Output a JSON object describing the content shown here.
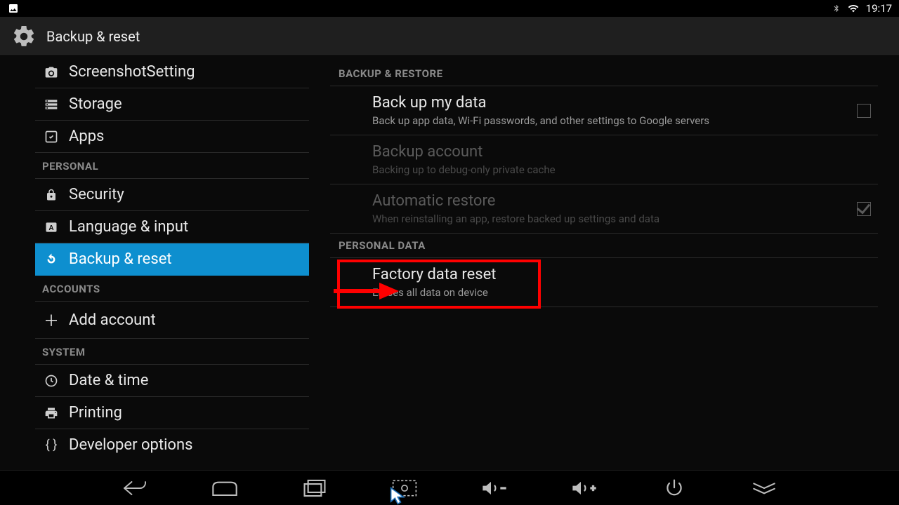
{
  "statusbar": {
    "time": "19:17"
  },
  "appbar": {
    "title": "Backup & reset"
  },
  "sidebar": {
    "items": [
      {
        "type": "item",
        "icon": "camera",
        "label": "ScreenshotSetting"
      },
      {
        "type": "item",
        "icon": "storage",
        "label": "Storage"
      },
      {
        "type": "item",
        "icon": "apps",
        "label": "Apps"
      },
      {
        "type": "header",
        "label": "PERSONAL"
      },
      {
        "type": "item",
        "icon": "lock",
        "label": "Security"
      },
      {
        "type": "item",
        "icon": "language",
        "label": "Language & input"
      },
      {
        "type": "item",
        "icon": "refresh",
        "label": "Backup & reset",
        "selected": true
      },
      {
        "type": "header",
        "label": "ACCOUNTS"
      },
      {
        "type": "add",
        "label": "Add account"
      },
      {
        "type": "header",
        "label": "SYSTEM"
      },
      {
        "type": "item",
        "icon": "clock",
        "label": "Date & time"
      },
      {
        "type": "item",
        "icon": "print",
        "label": "Printing"
      },
      {
        "type": "item",
        "icon": "braces",
        "label": "Developer options"
      }
    ]
  },
  "pane": {
    "section1": "BACKUP & RESTORE",
    "backup_data": {
      "title": "Back up my data",
      "sub": "Back up app data, Wi-Fi passwords, and other settings to Google servers"
    },
    "backup_account": {
      "title": "Backup account",
      "sub": "Backing up to debug-only private cache"
    },
    "auto_restore": {
      "title": "Automatic restore",
      "sub": "When reinstalling an app, restore backed up settings and data"
    },
    "section2": "PERSONAL DATA",
    "factory_reset": {
      "title": "Factory data reset",
      "sub": "Erases all data on device"
    }
  }
}
